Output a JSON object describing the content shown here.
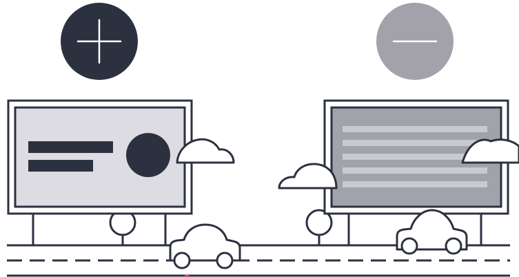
{
  "colors": {
    "ink": "#2c3140",
    "light_panel": "#dcdce2",
    "dark_panel": "#a2a2ab",
    "muted_circle": "#a3a2ab",
    "text_lines": "#c9c9d0",
    "background": "#ffffff",
    "accent": "#e8447a"
  },
  "icons": {
    "left": "plus-icon",
    "right": "minus-icon"
  }
}
